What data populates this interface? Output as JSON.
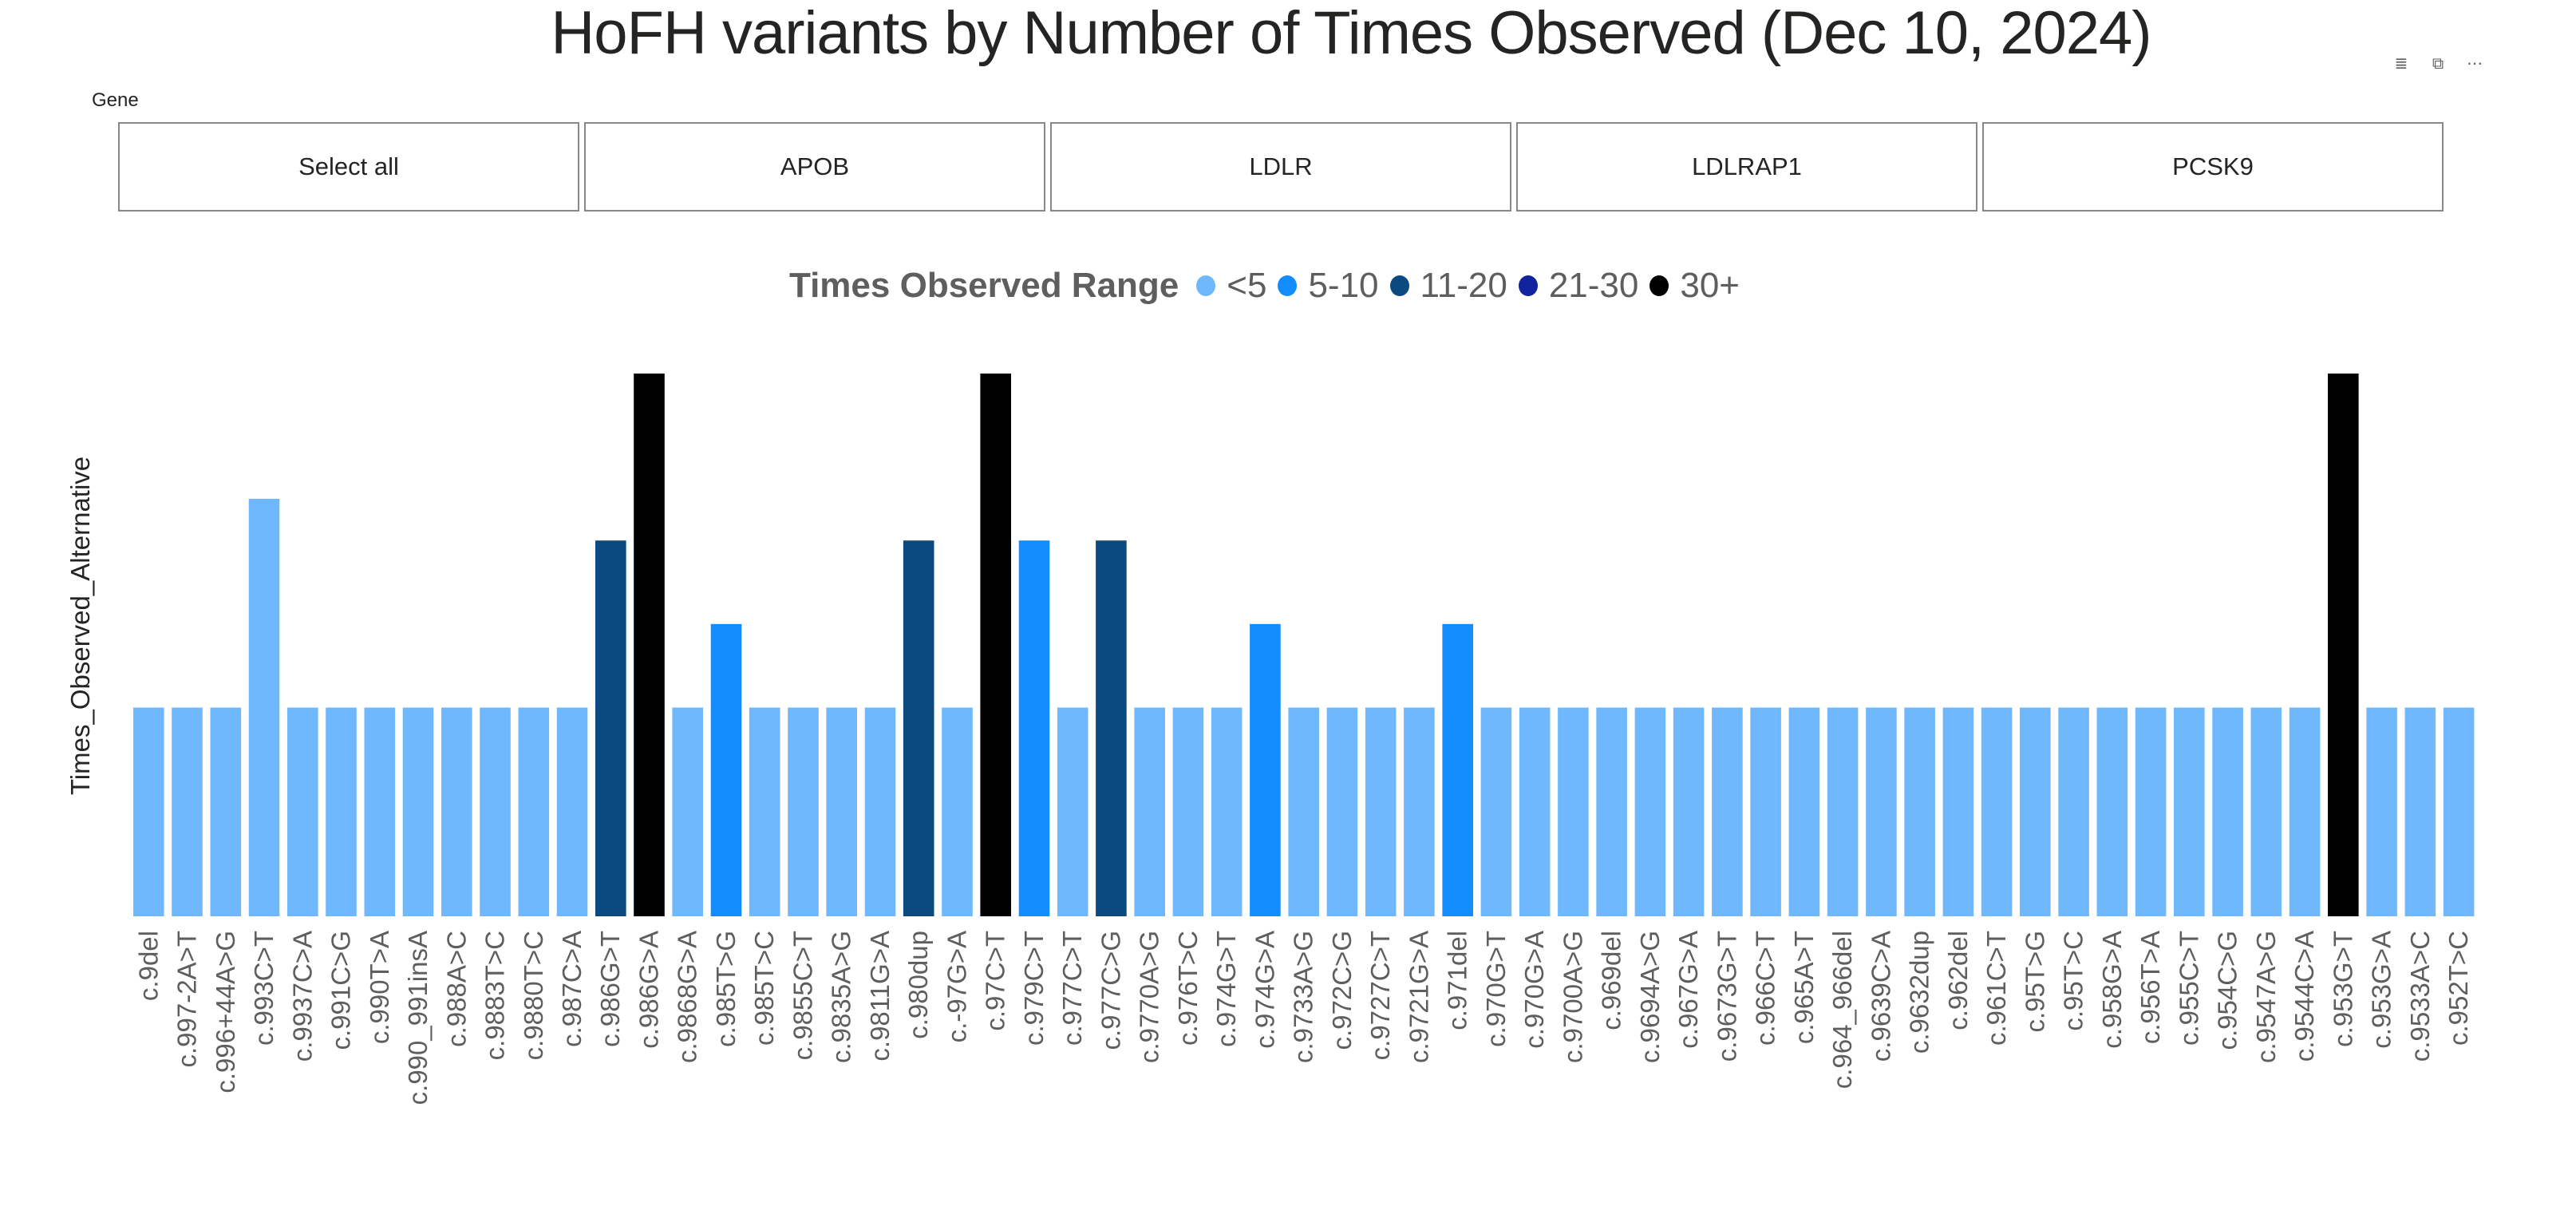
{
  "title": "HoFH variants by Number of Times Observed (Dec 10, 2024)",
  "header_icons": [
    {
      "name": "filter-icon",
      "glyph": "≣"
    },
    {
      "name": "focus-mode-icon",
      "glyph": "⧉"
    },
    {
      "name": "more-options-icon",
      "glyph": "⋯"
    }
  ],
  "slicer": {
    "label": "Gene",
    "options": [
      "Select all",
      "APOB",
      "LDLR",
      "LDLRAP1",
      "PCSK9"
    ]
  },
  "chart_data": {
    "type": "bar",
    "title": "HoFH variants by Number of Times Observed (Dec 10, 2024)",
    "xlabel": "",
    "ylabel": "Times_Observed_Alternative",
    "ylim": [
      0,
      6.5
    ],
    "grid": false,
    "legend": {
      "title": "Times Observed Range",
      "placement": "top-center",
      "entries": [
        {
          "label": "<5",
          "color": "#6FB8FD"
        },
        {
          "label": "5-10",
          "color": "#118DFF"
        },
        {
          "label": "11-20",
          "color": "#0B4A80"
        },
        {
          "label": "21-30",
          "color": "#12239E"
        },
        {
          "label": "30+",
          "color": "#000000"
        }
      ]
    },
    "categories": [
      "c.9del",
      "c.997-2A>T",
      "c.996+44A>G",
      "c.993C>T",
      "c.9937C>A",
      "c.991C>G",
      "c.990T>A",
      "c.990_991insA",
      "c.988A>C",
      "c.9883T>C",
      "c.9880T>C",
      "c.987C>A",
      "c.986G>T",
      "c.986G>A",
      "c.9868G>A",
      "c.985T>G",
      "c.985T>C",
      "c.9855C>T",
      "c.9835A>G",
      "c.9811G>A",
      "c.980dup",
      "c.-97G>A",
      "c.97C>T",
      "c.979C>T",
      "c.977C>T",
      "c.977C>G",
      "c.9770A>G",
      "c.976T>C",
      "c.974G>T",
      "c.974G>A",
      "c.9733A>G",
      "c.972C>G",
      "c.9727C>T",
      "c.9721G>A",
      "c.971del",
      "c.970G>T",
      "c.970G>A",
      "c.9700A>G",
      "c.969del",
      "c.9694A>G",
      "c.967G>A",
      "c.9673G>T",
      "c.966C>T",
      "c.965A>T",
      "c.964_966del",
      "c.9639C>A",
      "c.9632dup",
      "c.962del",
      "c.961C>T",
      "c.95T>G",
      "c.95T>C",
      "c.958G>A",
      "c.956T>A",
      "c.955C>T",
      "c.954C>G",
      "c.9547A>G",
      "c.9544C>A",
      "c.953G>T",
      "c.953G>A",
      "c.9533A>C",
      "c.952T>C"
    ],
    "values": [
      2.5,
      2.5,
      2.5,
      5.0,
      2.5,
      2.5,
      2.5,
      2.5,
      2.5,
      2.5,
      2.5,
      2.5,
      4.5,
      6.5,
      2.5,
      3.5,
      2.5,
      2.5,
      2.5,
      2.5,
      4.5,
      2.5,
      6.5,
      4.5,
      2.5,
      4.5,
      2.5,
      2.5,
      2.5,
      3.5,
      2.5,
      2.5,
      2.5,
      2.5,
      3.5,
      2.5,
      2.5,
      2.5,
      2.5,
      2.5,
      2.5,
      2.5,
      2.5,
      2.5,
      2.5,
      2.5,
      2.5,
      2.5,
      2.5,
      2.5,
      2.5,
      2.5,
      2.5,
      2.5,
      2.5,
      2.5,
      2.5,
      6.5,
      2.5,
      2.5,
      2.5
    ],
    "range_category": [
      "<5",
      "<5",
      "<5",
      "<5",
      "<5",
      "<5",
      "<5",
      "<5",
      "<5",
      "<5",
      "<5",
      "<5",
      "11-20",
      "30+",
      "<5",
      "5-10",
      "<5",
      "<5",
      "<5",
      "<5",
      "11-20",
      "<5",
      "30+",
      "5-10",
      "<5",
      "11-20",
      "<5",
      "<5",
      "<5",
      "5-10",
      "<5",
      "<5",
      "<5",
      "<5",
      "5-10",
      "<5",
      "<5",
      "<5",
      "<5",
      "<5",
      "<5",
      "<5",
      "<5",
      "<5",
      "<5",
      "<5",
      "<5",
      "<5",
      "<5",
      "<5",
      "<5",
      "<5",
      "<5",
      "<5",
      "<5",
      "<5",
      "<5",
      "30+",
      "<5",
      "<5",
      "<5"
    ]
  }
}
